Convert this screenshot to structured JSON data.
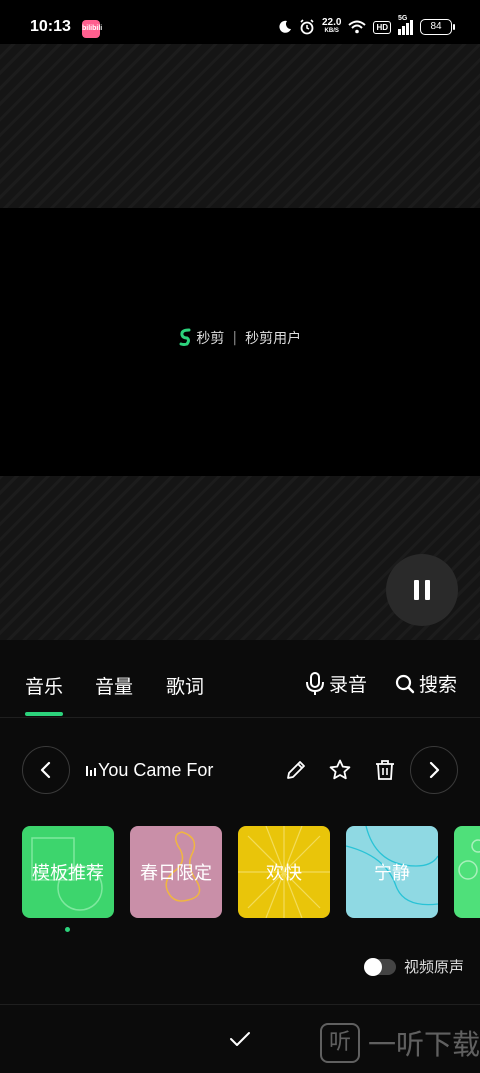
{
  "status_bar": {
    "time": "10:13",
    "app_badge": "bilibili",
    "net_speed": "22.0",
    "net_unit": "KB/S",
    "hd": "HD",
    "signal": "5G",
    "battery": "84"
  },
  "preview": {
    "watermark_logo": "秒剪",
    "watermark_user": "秒剪用户"
  },
  "tabs": [
    {
      "label": "音乐",
      "active": true
    },
    {
      "label": "音量",
      "active": false
    },
    {
      "label": "歌词",
      "active": false
    }
  ],
  "actions": {
    "record": "录音",
    "search": "搜索"
  },
  "music": {
    "current_song": "You Came For"
  },
  "categories": [
    {
      "label": "模板推荐",
      "color": "#3dd56d"
    },
    {
      "label": "春日限定",
      "color": "#c98fa8"
    },
    {
      "label": "欢快",
      "color": "#e9c50a"
    },
    {
      "label": "宁静",
      "color": "#8fd9e3"
    },
    {
      "label": "",
      "color": "#4fe07a"
    }
  ],
  "original_sound": {
    "label": "视频原声",
    "enabled": false
  },
  "site_watermark": {
    "glyph": "听",
    "text": "一听下载"
  },
  "colors": {
    "accent": "#2cd37c",
    "panel_bg": "#0b0b0b"
  }
}
